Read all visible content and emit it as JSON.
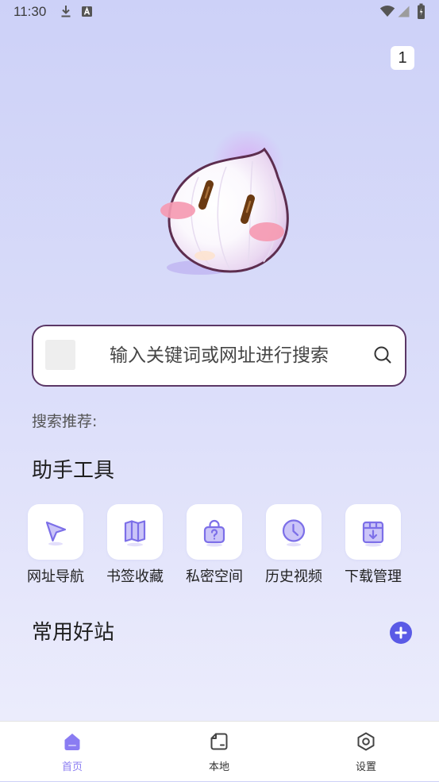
{
  "status_bar": {
    "time": "11:30",
    "left_icons": [
      "download-icon",
      "a-notification-icon"
    ],
    "right_icons": [
      "wifi-icon",
      "signal-icon",
      "battery-icon"
    ]
  },
  "header": {
    "tab_count": "1"
  },
  "mascot": {
    "icon": "onion-mascot-icon"
  },
  "search": {
    "placeholder": "输入关键词或网址进行搜索",
    "icon": "search-icon"
  },
  "recommend": {
    "label": "搜索推荐:"
  },
  "tools": {
    "title": "助手工具",
    "items": [
      {
        "label": "网址导航",
        "icon": "navigation-arrow-icon"
      },
      {
        "label": "书签收藏",
        "icon": "bookmark-map-icon"
      },
      {
        "label": "私密空间",
        "icon": "private-bag-icon"
      },
      {
        "label": "历史视频",
        "icon": "clock-icon"
      },
      {
        "label": "下载管理",
        "icon": "download-box-icon"
      }
    ]
  },
  "favorites": {
    "title": "常用好站",
    "add_icon": "plus-circle-icon"
  },
  "bottom_nav": {
    "items": [
      {
        "label": "首页",
        "icon": "home-icon",
        "active": true
      },
      {
        "label": "本地",
        "icon": "folder-icon",
        "active": false
      },
      {
        "label": "设置",
        "icon": "settings-icon",
        "active": false
      }
    ]
  },
  "colors": {
    "background_top": "#cdd1f8",
    "background_bottom": "#eeeffc",
    "accent": "#8a7cf2",
    "add_button": "#5a5ae6",
    "search_border": "#5b3766",
    "icon_stroke": "#7c6fe8",
    "icon_fill": "#cbc5f8"
  }
}
